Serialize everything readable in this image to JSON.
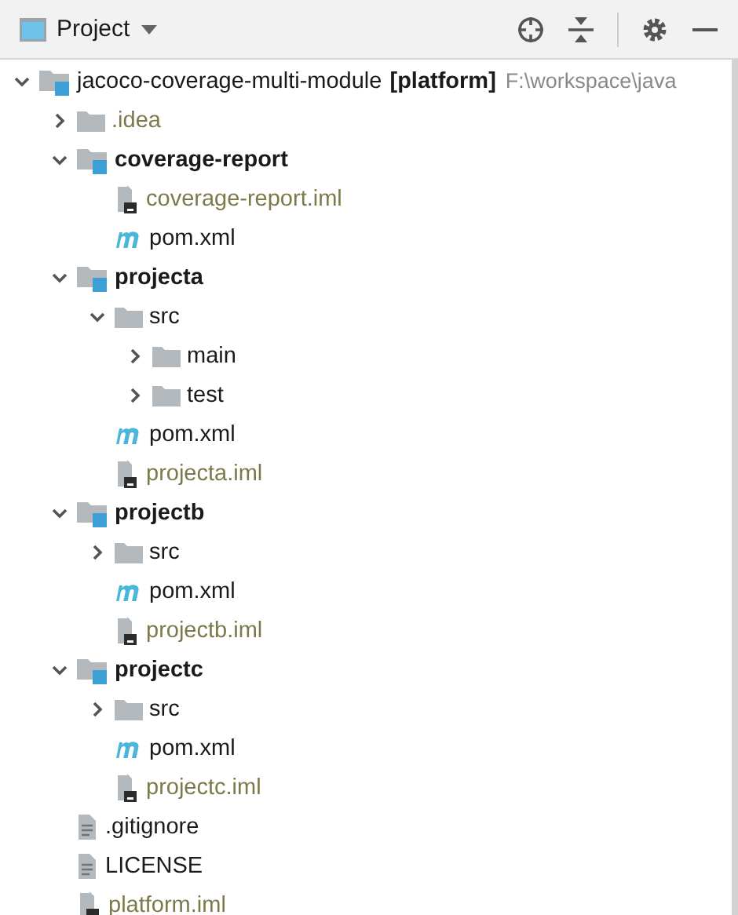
{
  "toolbar": {
    "title": "Project"
  },
  "tree": [
    {
      "kind": "module",
      "label": "jacoco-coverage-multi-module",
      "module_tag": "[platform]",
      "path": "F:\\workspace\\java",
      "bold": false,
      "ignored": false,
      "expanded": true,
      "children": [
        {
          "kind": "folder",
          "label": ".idea",
          "bold": false,
          "ignored": true,
          "expanded": false
        },
        {
          "kind": "module",
          "label": "coverage-report",
          "bold": true,
          "ignored": false,
          "expanded": true,
          "children": [
            {
              "kind": "iml",
              "label": "coverage-report.iml",
              "bold": false,
              "ignored": true
            },
            {
              "kind": "maven",
              "label": "pom.xml",
              "bold": false,
              "ignored": false
            }
          ]
        },
        {
          "kind": "module",
          "label": "projecta",
          "bold": true,
          "ignored": false,
          "expanded": true,
          "children": [
            {
              "kind": "folder",
              "label": "src",
              "bold": false,
              "ignored": false,
              "expanded": true,
              "children": [
                {
                  "kind": "folder",
                  "label": "main",
                  "bold": false,
                  "ignored": false,
                  "expanded": false
                },
                {
                  "kind": "folder",
                  "label": "test",
                  "bold": false,
                  "ignored": false,
                  "expanded": false
                }
              ]
            },
            {
              "kind": "maven",
              "label": "pom.xml",
              "bold": false,
              "ignored": false
            },
            {
              "kind": "iml",
              "label": "projecta.iml",
              "bold": false,
              "ignored": true
            }
          ]
        },
        {
          "kind": "module",
          "label": "projectb",
          "bold": true,
          "ignored": false,
          "expanded": true,
          "children": [
            {
              "kind": "folder",
              "label": "src",
              "bold": false,
              "ignored": false,
              "expanded": false
            },
            {
              "kind": "maven",
              "label": "pom.xml",
              "bold": false,
              "ignored": false
            },
            {
              "kind": "iml",
              "label": "projectb.iml",
              "bold": false,
              "ignored": true
            }
          ]
        },
        {
          "kind": "module",
          "label": "projectc",
          "bold": true,
          "ignored": false,
          "expanded": true,
          "children": [
            {
              "kind": "folder",
              "label": "src",
              "bold": false,
              "ignored": false,
              "expanded": false
            },
            {
              "kind": "maven",
              "label": "pom.xml",
              "bold": false,
              "ignored": false
            },
            {
              "kind": "iml",
              "label": "projectc.iml",
              "bold": false,
              "ignored": true
            }
          ]
        },
        {
          "kind": "text",
          "label": ".gitignore",
          "bold": false,
          "ignored": false
        },
        {
          "kind": "text",
          "label": "LICENSE",
          "bold": false,
          "ignored": false
        },
        {
          "kind": "iml",
          "label": "platform.iml",
          "bold": false,
          "ignored": true
        }
      ]
    }
  ]
}
